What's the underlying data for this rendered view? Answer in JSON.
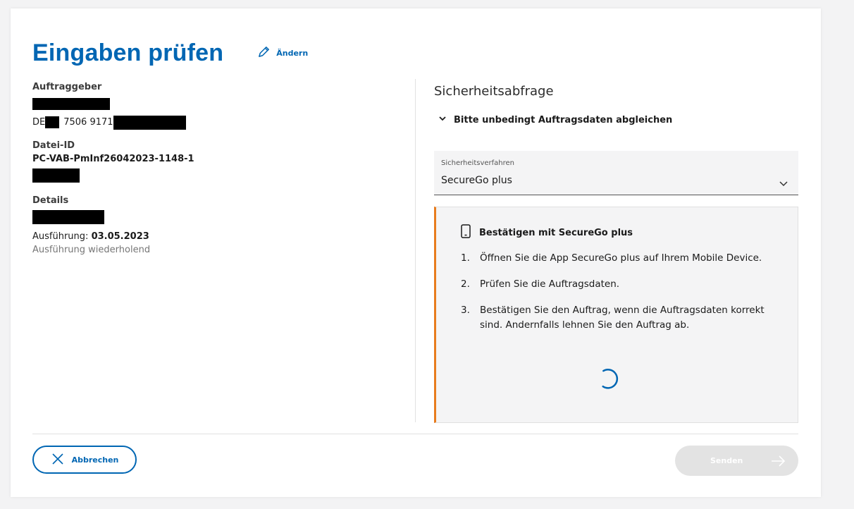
{
  "header": {
    "title": "Eingaben prüfen",
    "edit_label": "Ändern"
  },
  "left": {
    "client_label": "Auftraggeber",
    "iban_prefix": "DE",
    "iban_middle": "7506 9171",
    "file_id_label": "Datei-ID",
    "file_id_value": "PC-VAB-PmInf26042023-1148-1",
    "details_label": "Details",
    "execution_label": "Ausführung:",
    "execution_date": "03.05.2023",
    "repeating_text": "Ausführung wiederholend"
  },
  "security": {
    "title": "Sicherheitsabfrage",
    "toggle_label": "Bitte unbedingt Auftragsdaten abgleichen",
    "select_label": "Sicherheitsverfahren",
    "select_value": "SecureGo plus",
    "panel_title": "Bestätigen mit SecureGo plus",
    "steps": [
      {
        "num": "1.",
        "text": "Öffnen Sie die App SecureGo plus auf Ihrem Mobile Device."
      },
      {
        "num": "2.",
        "text": "Prüfen Sie die Auftragsdaten."
      },
      {
        "num": "3.",
        "text": "Bestätigen Sie den Auftrag, wenn die Auftragsdaten korrekt sind. Andernfalls lehnen Sie den Auftrag ab."
      }
    ]
  },
  "footer": {
    "cancel_label": "Abbrechen",
    "send_label": "Senden"
  },
  "colors": {
    "accent": "#0066b3",
    "panel_border": "#e87c1e",
    "disabled_button": "#e3e3e3"
  },
  "icons": {
    "edit": "pencil-icon",
    "toggle": "chevron-down-icon",
    "select": "chevron-down-icon",
    "panel": "smartphone-icon",
    "cancel": "close-icon",
    "send": "arrow-right-icon",
    "loading": "spinner-icon"
  }
}
